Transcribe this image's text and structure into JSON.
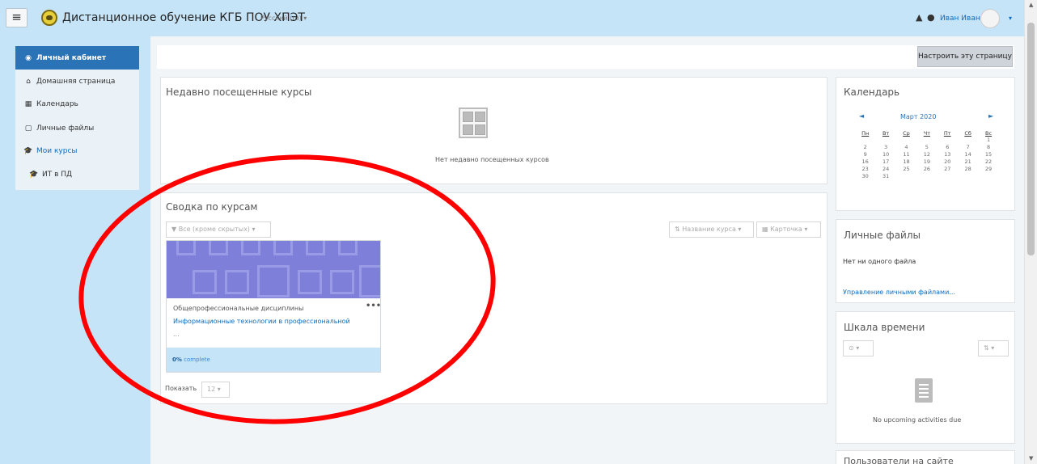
{
  "topbar": {
    "menu_icon": "hamburger-icon",
    "site_name": "Дистанционное обучение КГБ ПОУ ХПЭТ",
    "language": "Русский (ru) ▾",
    "notifications_icon": "bell-icon",
    "messages_icon": "chat-icon",
    "user_name": "Иван Иванов",
    "user_menu_caret": "▾",
    "bar_color": "#c6e4f7"
  },
  "sidebar": {
    "items": [
      {
        "label": "Личный кабинет",
        "icon": "dashboard-icon",
        "glyph": "◉",
        "active": true
      },
      {
        "label": "Домашняя страница",
        "icon": "home-icon",
        "glyph": "⌂"
      },
      {
        "label": "Календарь",
        "icon": "calendar-icon",
        "glyph": "▦"
      },
      {
        "label": "Личные файлы",
        "icon": "file-icon",
        "glyph": "▢"
      },
      {
        "label": "Мои курсы",
        "icon": "graduation-cap-icon",
        "glyph": "🎓"
      },
      {
        "label": "ИТ в ПД",
        "icon": "graduation-cap-icon",
        "glyph": "🎓"
      }
    ],
    "active_color": "#2b73b7"
  },
  "header": {
    "customize_label": "Настроить эту страницу"
  },
  "recent_courses": {
    "title": "Недавно посещенные курсы",
    "empty_text": "Нет недавно посещенных курсов"
  },
  "course_overview": {
    "title": "Сводка по курсам",
    "filter_label": "▼ Все (кроме скрытых) ▾",
    "sort_label": "⇅ Название курса ▾",
    "view_label": "▦ Карточка ▾",
    "course": {
      "category": "Общепрофессиональные дисциплины",
      "name": "Информационные технологии в профессиональной",
      "more": "...",
      "menu": "•••",
      "progress_value": "0%",
      "progress_suffix": " complete",
      "image_color": "#7e7fd9"
    },
    "show_label": "Показать",
    "show_value": "12 ▾"
  },
  "calendar": {
    "title": "Календарь",
    "month": "Март 2020",
    "prev": "◄",
    "next": "►",
    "weekdays": [
      "Пн",
      "Вт",
      "Ср",
      "Чт",
      "Пт",
      "Сб",
      "Вс"
    ],
    "weeks": [
      [
        "",
        "",
        "",
        "",
        "",
        "",
        "1"
      ],
      [
        "2",
        "3",
        "4",
        "5",
        "6",
        "7",
        "8"
      ],
      [
        "9",
        "10",
        "11",
        "12",
        "13",
        "14",
        "15"
      ],
      [
        "16",
        "17",
        "18",
        "19",
        "20",
        "21",
        "22"
      ],
      [
        "23",
        "24",
        "25",
        "26",
        "27",
        "28",
        "29"
      ],
      [
        "30",
        "31",
        "",
        "",
        "",
        "",
        ""
      ]
    ]
  },
  "private_files": {
    "title": "Личные файлы",
    "empty_text": "Нет ни одного файла",
    "manage_link": "Управление личными файлами..."
  },
  "timeline": {
    "title": "Шкала времени",
    "filter_label": "⊙ ▾",
    "sort_label": "⇅ ▾",
    "empty_text": "No upcoming activities due"
  },
  "online_users": {
    "title": "Пользователи на сайте"
  },
  "annotation": {
    "color": "#ff0000"
  }
}
